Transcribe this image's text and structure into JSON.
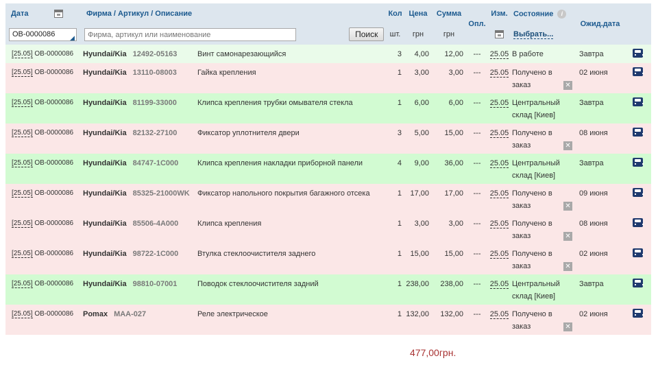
{
  "header": {
    "date_label": "Дата",
    "firm_label": "Фирма / Артикул / Описание",
    "qty_label": "Кол",
    "qty_unit": "шт.",
    "price_label": "Цена",
    "price_unit": "грн",
    "sum_label": "Сумма",
    "sum_unit": "грн",
    "paid_label": "Опл.",
    "changed_label": "Изм.",
    "state_label": "Состояние",
    "state_choose": "Выбрать...",
    "wait_label": "Ожид.дата",
    "date_value": "OB-0000086",
    "search_placeholder": "Фирма, артикул или наименование",
    "search_button": "Поиск"
  },
  "rows": [
    {
      "date": "[25.05]",
      "order": "OB-0000086",
      "brand": "Hyundai/Kia",
      "article": "12492-05163",
      "desc": "Винт самонарезающийся",
      "qty": "3",
      "price": "4,00",
      "sum": "12,00",
      "paid": "---",
      "changed": "25.05",
      "state": "В работе",
      "wait": "Завтра",
      "status": "green",
      "cancel": false
    },
    {
      "date": "[25.05]",
      "order": "OB-0000086",
      "brand": "Hyundai/Kia",
      "article": "13110-08003",
      "desc": "Гайка крепления",
      "qty": "1",
      "price": "3,00",
      "sum": "3,00",
      "paid": "---",
      "changed": "25.05",
      "state": "Получено в заказ",
      "wait": "02 июня",
      "status": "pink",
      "cancel": true
    },
    {
      "date": "[25.05]",
      "order": "OB-0000086",
      "brand": "Hyundai/Kia",
      "article": "81199-33000",
      "desc": "Клипса крепления трубки омывателя стекла",
      "qty": "1",
      "price": "6,00",
      "sum": "6,00",
      "paid": "---",
      "changed": "25.05",
      "state": "Центральный склад [Киев]",
      "wait": "Завтра",
      "status": "green",
      "cancel": false
    },
    {
      "date": "[25.05]",
      "order": "OB-0000086",
      "brand": "Hyundai/Kia",
      "article": "82132-27100",
      "desc": "Фиксатор уплотнителя двери",
      "qty": "3",
      "price": "5,00",
      "sum": "15,00",
      "paid": "---",
      "changed": "25.05",
      "state": "Получено в заказ",
      "wait": "08 июня",
      "status": "pink",
      "cancel": true
    },
    {
      "date": "[25.05]",
      "order": "OB-0000086",
      "brand": "Hyundai/Kia",
      "article": "84747-1C000",
      "desc": "Клипса крепления накладки приборной панели",
      "qty": "4",
      "price": "9,00",
      "sum": "36,00",
      "paid": "---",
      "changed": "25.05",
      "state": "Центральный склад [Киев]",
      "wait": "Завтра",
      "status": "green",
      "cancel": false
    },
    {
      "date": "[25.05]",
      "order": "OB-0000086",
      "brand": "Hyundai/Kia",
      "article": "85325-21000WK",
      "desc": "Фиксатор напольного покрытия багажного отсека",
      "qty": "1",
      "price": "17,00",
      "sum": "17,00",
      "paid": "---",
      "changed": "25.05",
      "state": "Получено в заказ",
      "wait": "09 июня",
      "status": "pink",
      "cancel": true
    },
    {
      "date": "[25.05]",
      "order": "OB-0000086",
      "brand": "Hyundai/Kia",
      "article": "85506-4A000",
      "desc": "Клипса крепления",
      "qty": "1",
      "price": "3,00",
      "sum": "3,00",
      "paid": "---",
      "changed": "25.05",
      "state": "Получено в заказ",
      "wait": "08 июня",
      "status": "pink",
      "cancel": true
    },
    {
      "date": "[25.05]",
      "order": "OB-0000086",
      "brand": "Hyundai/Kia",
      "article": "98722-1C000",
      "desc": "Втулка стеклоочистителя заднего",
      "qty": "1",
      "price": "15,00",
      "sum": "15,00",
      "paid": "---",
      "changed": "25.05",
      "state": "Получено в заказ",
      "wait": "02 июня",
      "status": "pink",
      "cancel": true
    },
    {
      "date": "[25.05]",
      "order": "OB-0000086",
      "brand": "Hyundai/Kia",
      "article": "98810-07001",
      "desc": "Поводок стеклоочистителя задний",
      "qty": "1",
      "price": "238,00",
      "sum": "238,00",
      "paid": "---",
      "changed": "25.05",
      "state": "Центральный склад [Киев]",
      "wait": "Завтра",
      "status": "green",
      "cancel": false
    },
    {
      "date": "[25.05]",
      "order": "OB-0000086",
      "brand": "Pomax",
      "article": "MAA-027",
      "desc": "Реле электрическое",
      "qty": "1",
      "price": "132,00",
      "sum": "132,00",
      "paid": "---",
      "changed": "25.05",
      "state": "Получено в заказ",
      "wait": "02 июня",
      "status": "pink",
      "cancel": true
    }
  ],
  "icons": {
    "calendar": "calendar-icon",
    "info": "info-icon",
    "cancel": "close-icon",
    "car": "car-icon"
  },
  "colors": {
    "header_bg": "#dde6ee",
    "header_text": "#1c5a8f",
    "row_green": "#d2fbd2",
    "row_pink": "#fbe7e7",
    "total_text": "#a83232"
  },
  "total": "477,00грн."
}
